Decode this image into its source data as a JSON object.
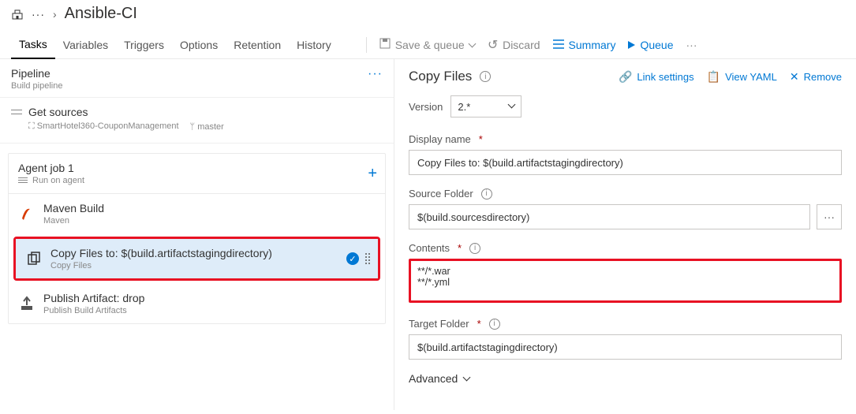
{
  "breadcrumb": {
    "title": "Ansible-CI"
  },
  "tabs": [
    "Tasks",
    "Variables",
    "Triggers",
    "Options",
    "Retention",
    "History"
  ],
  "toolbar": {
    "save_queue": "Save & queue",
    "discard": "Discard",
    "summary": "Summary",
    "queue": "Queue"
  },
  "pipeline": {
    "title": "Pipeline",
    "subtitle": "Build pipeline"
  },
  "sources": {
    "title": "Get sources",
    "repo": "SmartHotel360-CouponManagement",
    "branch": "master"
  },
  "agent": {
    "title": "Agent job 1",
    "subtitle": "Run on agent"
  },
  "tasks_list": [
    {
      "title": "Maven Build",
      "subtitle": "Maven"
    },
    {
      "title": "Copy Files to: $(build.artifactstagingdirectory)",
      "subtitle": "Copy Files"
    },
    {
      "title": "Publish Artifact: drop",
      "subtitle": "Publish Build Artifacts"
    }
  ],
  "rightPanel": {
    "header": "Copy Files",
    "link_settings": "Link settings",
    "view_yaml": "View YAML",
    "remove": "Remove",
    "version_label": "Version",
    "version_value": "2.*",
    "display_name_label": "Display name",
    "display_name_value": "Copy Files to: $(build.artifactstagingdirectory)",
    "source_folder_label": "Source Folder",
    "source_folder_value": "$(build.sourcesdirectory)",
    "contents_label": "Contents",
    "contents_value": "**/*.war\n**/*.yml",
    "target_folder_label": "Target Folder",
    "target_folder_value": "$(build.artifactstagingdirectory)",
    "advanced": "Advanced"
  }
}
